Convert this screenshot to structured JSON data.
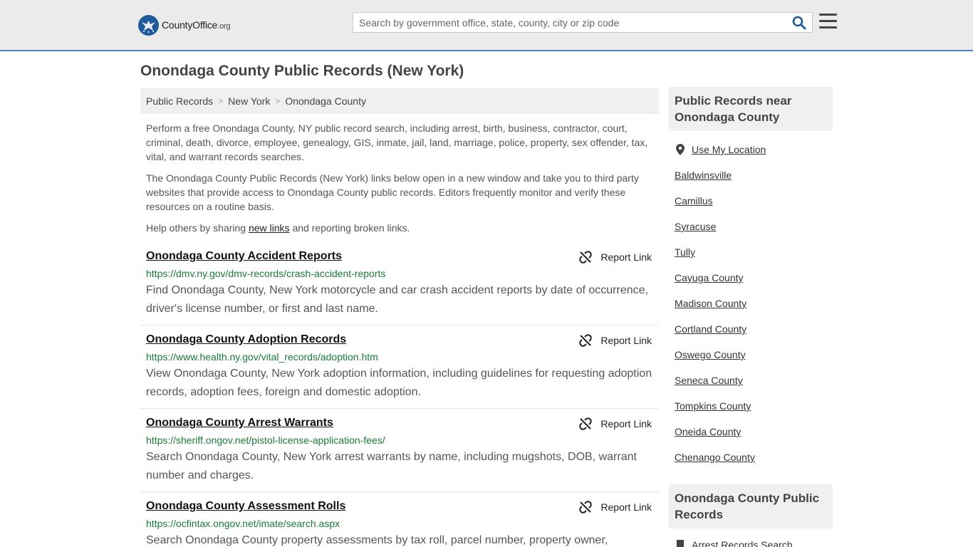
{
  "header": {
    "logo_main": "CountyOffice",
    "logo_org": ".org",
    "search_placeholder": "Search by government office, state, county, city or zip code"
  },
  "page_title": "Onondaga County Public Records (New York)",
  "breadcrumb": [
    "Public Records",
    "New York",
    "Onondaga County"
  ],
  "intro": {
    "p1": "Perform a free Onondaga County, NY public record search, including arrest, birth, business, contractor, court, criminal, death, divorce, employee, genealogy, GIS, inmate, jail, land, marriage, police, property, sex offender, tax, vital, and warrant records searches.",
    "p2": "The Onondaga County Public Records (New York) links below open in a new window and take you to third party websites that provide access to Onondaga County public records. Editors frequently monitor and verify these resources on a routine basis.",
    "p3_before": "Help others by sharing ",
    "p3_link": "new links",
    "p3_after": " and reporting broken links."
  },
  "report_label": "Report Link",
  "records": [
    {
      "title": "Onondaga County Accident Reports",
      "url": "https://dmv.ny.gov/dmv-records/crash-accident-reports",
      "desc": "Find Onondaga County, New York motorcycle and car crash accident reports by date of occurrence, driver's license number, or first and last name."
    },
    {
      "title": "Onondaga County Adoption Records",
      "url": "https://www.health.ny.gov/vital_records/adoption.htm",
      "desc": "View Onondaga County, New York adoption information, including guidelines for requesting adoption records, adoption fees, foreign and domestic adoption."
    },
    {
      "title": "Onondaga County Arrest Warrants",
      "url": "https://sheriff.ongov.net/pistol-license-application-fees/",
      "desc": "Search Onondaga County, New York arrest warrants by name, including mugshots, DOB, warrant number and charges."
    },
    {
      "title": "Onondaga County Assessment Rolls",
      "url": "https://ocfintax.ongov.net/imate/search.aspx",
      "desc": "Search Onondaga County property assessments by tax roll, parcel number, property owner,"
    }
  ],
  "sidebar": {
    "nearby_title": "Public Records near Onondaga County",
    "use_location": "Use My Location",
    "nearby": [
      "Baldwinsville",
      "Camillus",
      "Syracuse",
      "Tully",
      "Cayuga County",
      "Madison County",
      "Cortland County",
      "Oswego County",
      "Seneca County",
      "Tompkins County",
      "Oneida County",
      "Chenango County"
    ],
    "records_title": "Onondaga County Public Records",
    "records_first": "Arrest Records Search"
  }
}
